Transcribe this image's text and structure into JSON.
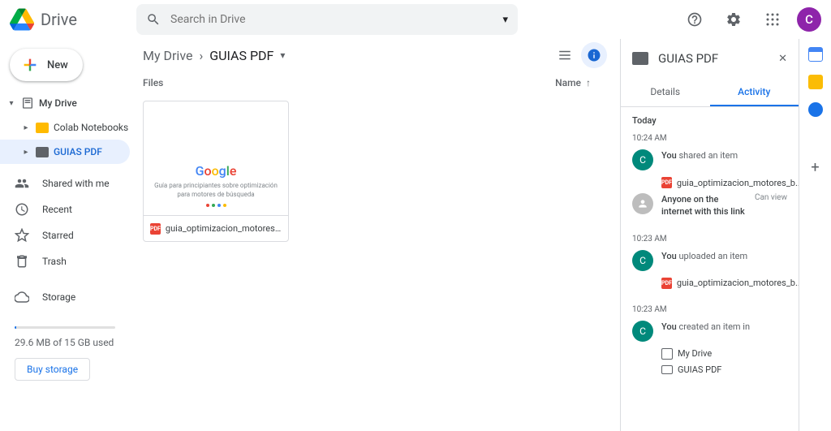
{
  "app": {
    "name": "Drive",
    "avatar_letter": "C"
  },
  "search": {
    "placeholder": "Search in Drive"
  },
  "new_button": "New",
  "tree": {
    "root": "My Drive",
    "children": [
      {
        "label": "Colab Notebooks",
        "selected": false
      },
      {
        "label": "GUIAS PDF",
        "selected": true
      }
    ]
  },
  "nav": {
    "shared": "Shared with me",
    "recent": "Recent",
    "starred": "Starred",
    "trash": "Trash",
    "storage": "Storage"
  },
  "storage": {
    "used_text": "29.6 MB of 15 GB used",
    "buy": "Buy storage"
  },
  "breadcrumb": {
    "root": "My Drive",
    "current": "GUIAS PDF"
  },
  "columns": {
    "files": "Files",
    "name": "Name"
  },
  "file": {
    "name": "guia_optimizacion_motores_busq...",
    "preview_text": "Guía para principiantes sobre optimización para motores de búsqueda"
  },
  "detail": {
    "title": "GUIAS PDF",
    "tabs": {
      "details": "Details",
      "activity": "Activity"
    },
    "day": "Today",
    "events": [
      {
        "time": "10:24 AM",
        "actor": "C",
        "you": "You",
        "verb": " shared an item",
        "item": "guia_optimizacion_motores_b...",
        "anon_text": "Anyone on the internet with this link",
        "can_view": "Can view"
      },
      {
        "time": "10:23 AM",
        "actor": "C",
        "you": "You",
        "verb": " uploaded an item",
        "item": "guia_optimizacion_motores_b..."
      },
      {
        "time": "10:23 AM",
        "actor": "C",
        "you": "You",
        "verb": " created an item in",
        "loc1": "My Drive",
        "loc2": "GUIAS PDF"
      }
    ]
  }
}
